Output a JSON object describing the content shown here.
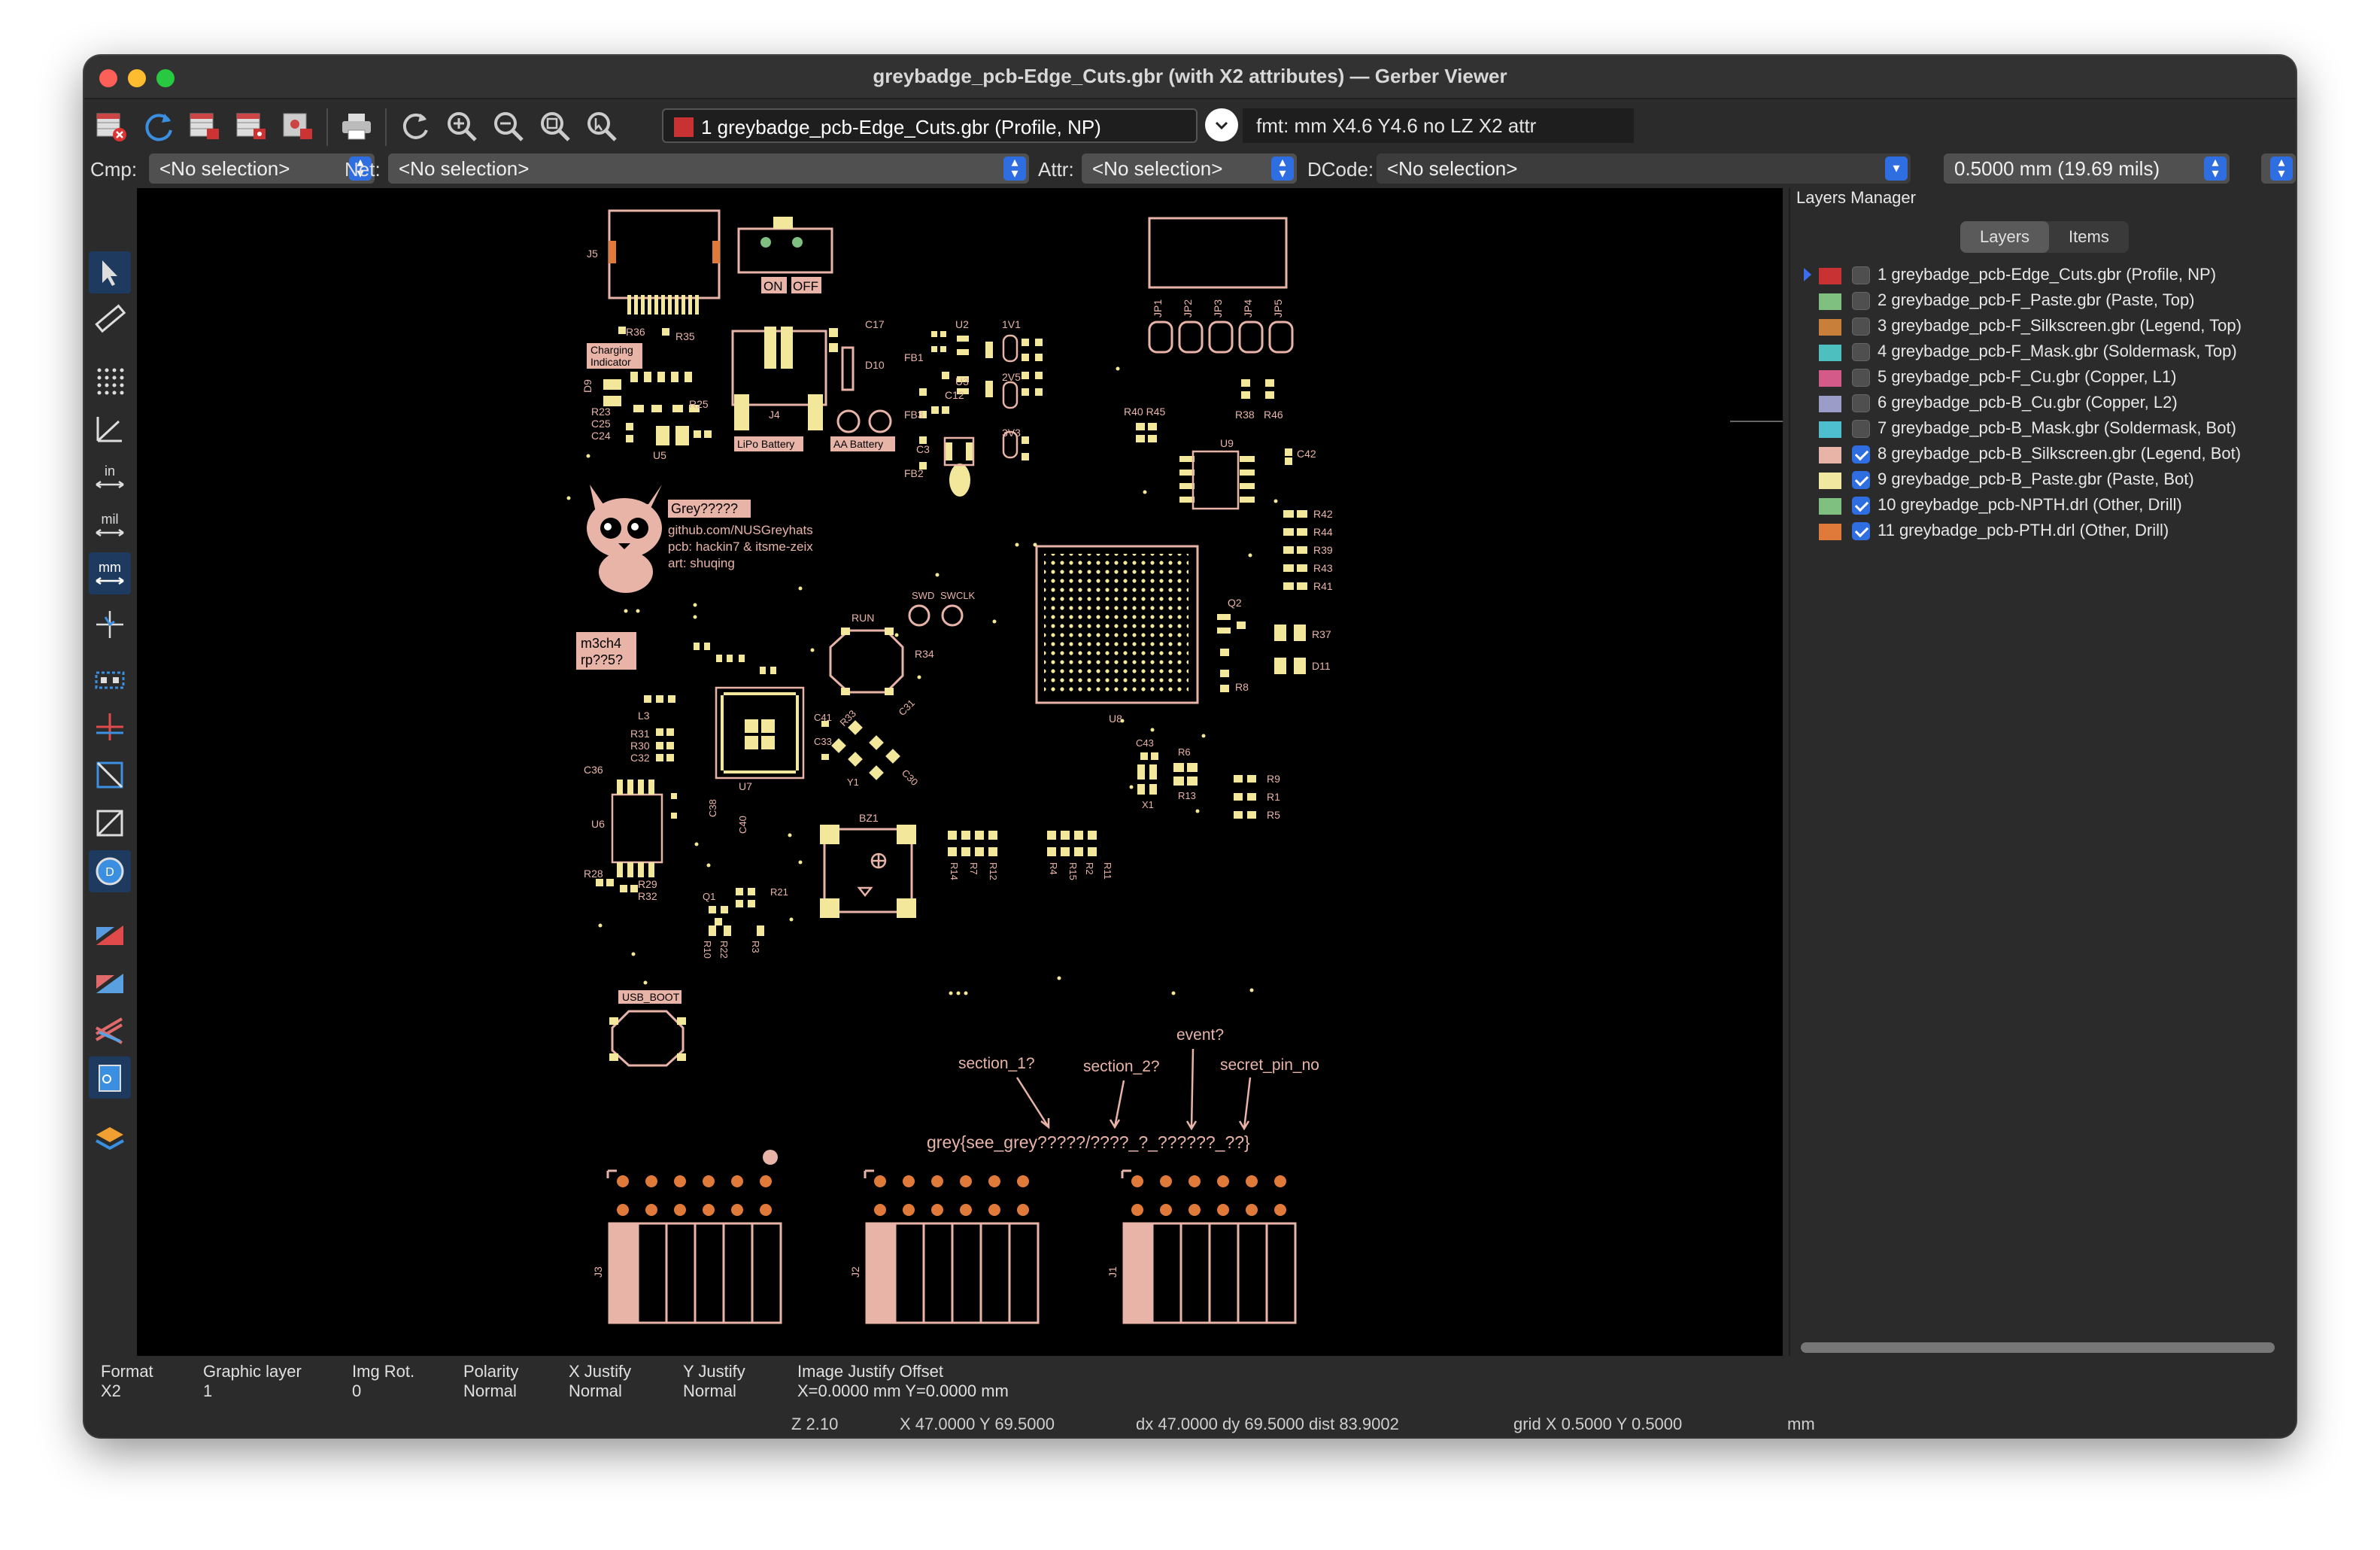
{
  "window": {
    "title": "greybadge_pcb-Edge_Cuts.gbr (with X2 attributes) — Gerber Viewer"
  },
  "toolbar": {
    "active_layer": "1 greybadge_pcb-Edge_Cuts.gbr (Profile, NP)",
    "format_info": "fmt: mm X4.6 Y4.6 no LZ X2 attr"
  },
  "filters": {
    "cmp_label": "Cmp:",
    "cmp_value": "<No selection>",
    "net_label": "Net:",
    "net_value": "<No selection>",
    "attr_label": "Attr:",
    "attr_value": "<No selection>",
    "dcode_label": "DCode:",
    "dcode_value": "<No selection>",
    "grid_value": "0.5000 mm (19.69 mils)"
  },
  "layers_manager": {
    "title": "Layers Manager",
    "tabs": [
      "Layers",
      "Items"
    ],
    "layers": [
      {
        "name": "1 greybadge_pcb-Edge_Cuts.gbr (Profile, NP)",
        "color": "#c83232",
        "checked": false
      },
      {
        "name": "2 greybadge_pcb-F_Paste.gbr (Paste, Top)",
        "color": "#7fbf7f",
        "checked": false
      },
      {
        "name": "3 greybadge_pcb-F_Silkscreen.gbr (Legend, Top)",
        "color": "#c87f3a",
        "checked": false
      },
      {
        "name": "4 greybadge_pcb-F_Mask.gbr (Soldermask, Top)",
        "color": "#4dbfbf",
        "checked": false
      },
      {
        "name": "5 greybadge_pcb-F_Cu.gbr (Copper, L1)",
        "color": "#d45a8a",
        "checked": false
      },
      {
        "name": "6 greybadge_pcb-B_Cu.gbr (Copper, L2)",
        "color": "#9c9cc8",
        "checked": false
      },
      {
        "name": "7 greybadge_pcb-B_Mask.gbr (Soldermask, Bot)",
        "color": "#4dbfcf",
        "checked": false
      },
      {
        "name": "8 greybadge_pcb-B_Silkscreen.gbr (Legend, Bot)",
        "color": "#e8b4a8",
        "checked": true
      },
      {
        "name": "9 greybadge_pcb-B_Paste.gbr (Paste, Bot)",
        "color": "#f0e8a0",
        "checked": true
      },
      {
        "name": "10 greybadge_pcb-NPTH.drl (Other, Drill)",
        "color": "#7fbf7f",
        "checked": true
      },
      {
        "name": "11 greybadge_pcb-PTH.drl (Other, Drill)",
        "color": "#e07a3a",
        "checked": true
      }
    ]
  },
  "status": {
    "format_label": "Format",
    "format_value": "X2",
    "graphic_layer_label": "Graphic layer",
    "graphic_layer_value": "1",
    "img_rot_label": "Img Rot.",
    "img_rot_value": "0",
    "polarity_label": "Polarity",
    "polarity_value": "Normal",
    "xjustify_label": "X Justify",
    "xjustify_value": "Normal",
    "yjustify_label": "Y Justify",
    "yjustify_value": "Normal",
    "offset_label": "Image Justify Offset",
    "offset_value": "X=0.0000 mm Y=0.0000 mm",
    "zoom": "Z 2.10",
    "cursor": "X 47.0000  Y 69.5000",
    "delta": "dx 47.0000  dy 69.5000  dist 83.9002",
    "grid": "grid X 0.5000  Y 0.5000",
    "units": "mm"
  },
  "board": {
    "j5": "J5",
    "on": "ON",
    "off": "OFF",
    "r36": "R36",
    "r35": "R35",
    "charging": "Charging",
    "indicator": "Indicator",
    "c17": "C17",
    "d10": "D10",
    "j4": "J4",
    "lipo": "LiPo Battery",
    "aa": "AA Battery",
    "u2": "U2",
    "u3": "U3",
    "fb1": "FB1",
    "fb3": "FB3",
    "fb2": "FB2",
    "c12": "C12",
    "c3": "C3",
    "v1v1": "1V1",
    "v2v5": "2V5",
    "v3v3": "3V3",
    "d9": "D9",
    "u5": "U5",
    "r23": "R23",
    "c25": "C25",
    "c24": "C24",
    "r25": "R25",
    "jp1": "JP1",
    "jp2": "JP2",
    "jp3": "JP3",
    "jp4": "JP4",
    "jp5": "JP5",
    "r40r45": "R40 R45",
    "r38": "R38",
    "r46": "R46",
    "u9": "U9",
    "c42": "C42",
    "r42": "R42",
    "r44": "R44",
    "r39": "R39",
    "r43": "R43",
    "r41": "R41",
    "grey": "Grey?????",
    "github": "github.com/NUSGreyhats",
    "pcb_credit": "pcb: hackin7 & itsme-zeix",
    "art_credit": "art: shuqing",
    "m3ch4": "m3ch4",
    "rp": "rp??5?",
    "swd": "SWD",
    "swclk": "SWCLK",
    "run": "RUN",
    "r34": "R34",
    "u8": "U8",
    "q2": "Q2",
    "r37": "R37",
    "d11": "D11",
    "r8": "R8",
    "l3": "L3",
    "r31": "R31",
    "r30": "R30",
    "c32": "C32",
    "c36": "C36",
    "u7": "U7",
    "c41": "C41",
    "c33": "C33",
    "r33": "R33",
    "c31": "C31",
    "y1": "Y1",
    "c30": "C30",
    "c43": "C43",
    "r6": "R6",
    "r13": "R13",
    "x1": "X1",
    "r9": "R9",
    "r1": "R1",
    "r5": "R5",
    "u6": "U6",
    "r28": "R28",
    "r29": "R29",
    "r32": "R32",
    "c38": "C38",
    "c40": "C40",
    "bz1": "BZ1",
    "q1": "Q1",
    "r21": "R21",
    "r10": "R10",
    "r22": "R22",
    "r3": "R3",
    "r14": "R14",
    "r7": "R7",
    "r12": "R12",
    "r4": "R4",
    "r15": "R15",
    "r2": "R2",
    "r11": "R11",
    "usb_boot": "USB_BOOT",
    "section1": "section_1?",
    "section2": "section_2?",
    "event": "event?",
    "secret": "secret_pin_no",
    "flag": "grey{see_grey?????/????_?_??????_??}",
    "j3": "J3",
    "j2": "J2",
    "j1": "J1"
  }
}
